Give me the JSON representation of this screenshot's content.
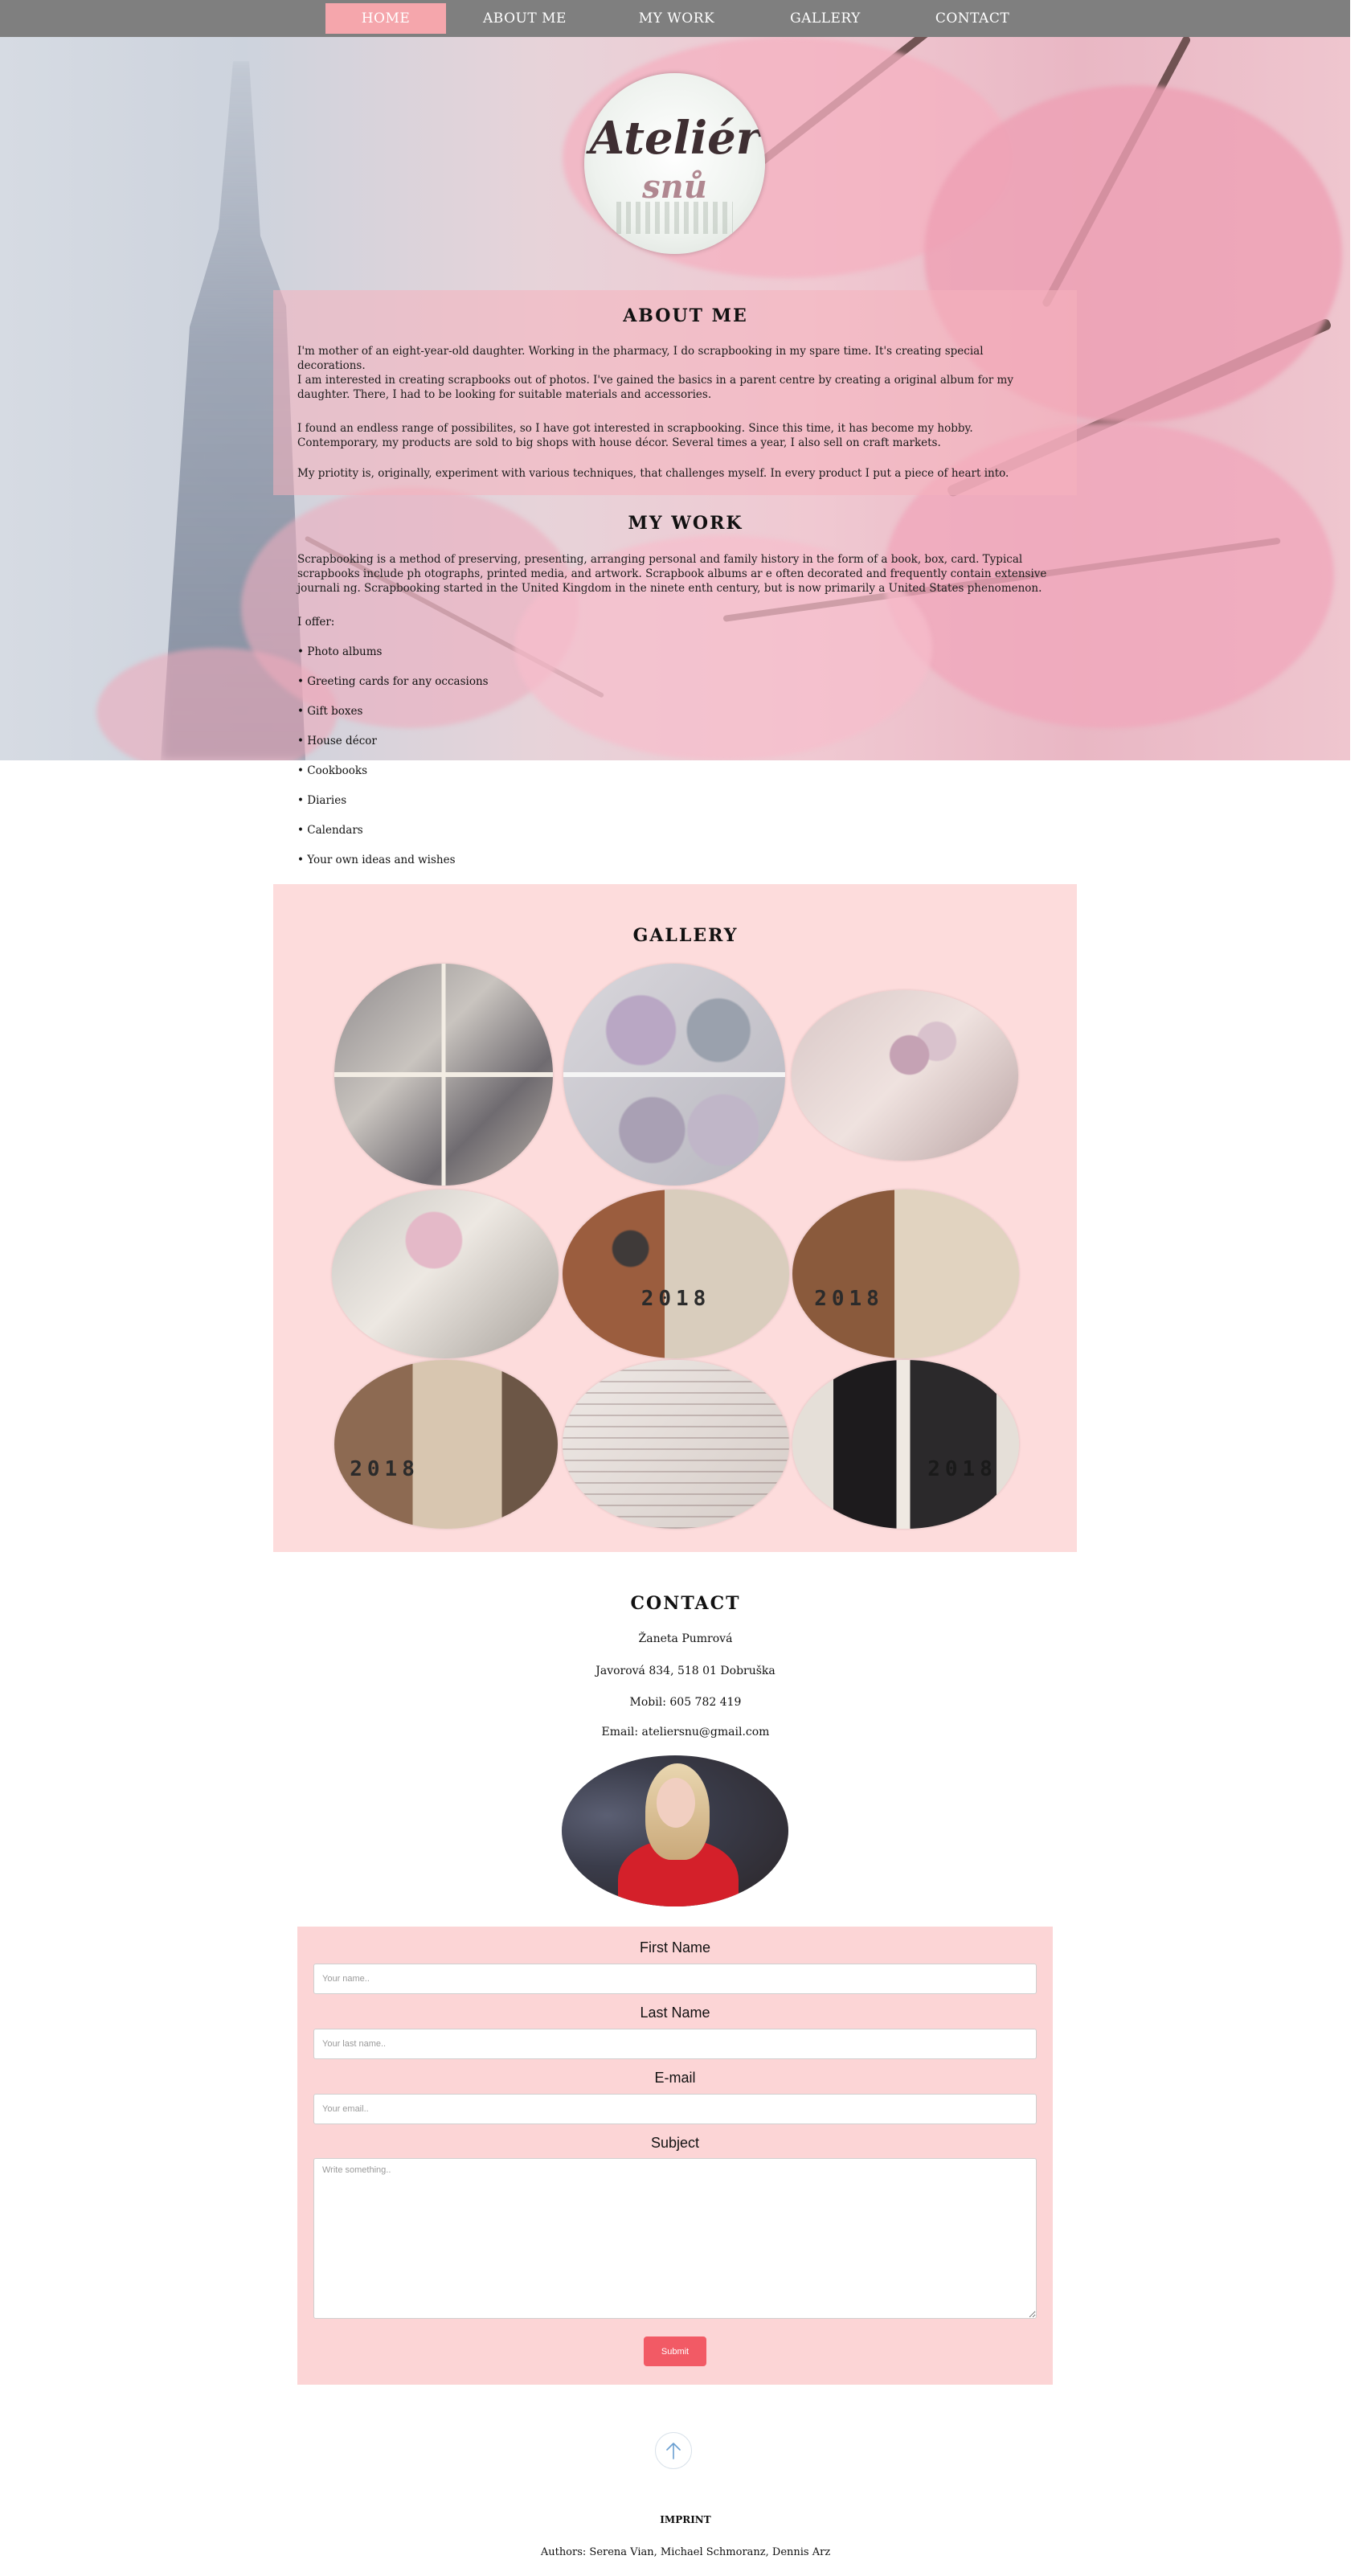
{
  "nav": {
    "items": [
      {
        "label": "HOME",
        "active": true
      },
      {
        "label": "ABOUT ME",
        "active": false
      },
      {
        "label": "MY WORK",
        "active": false
      },
      {
        "label": "GALLERY",
        "active": false
      },
      {
        "label": "CONTACT",
        "active": false
      }
    ],
    "active_color": "#f5a6ac",
    "bar_color": "#7f7f7f"
  },
  "logo": {
    "line1": "Ateliér",
    "line2": "snů"
  },
  "about": {
    "title": "ABOUT ME",
    "paragraphs": [
      "I'm mother of an eight-year-old daughter. Working in the pharmacy, I do scrapbooking in my spare time. It's creating special decorations.",
      "I am interested in creating scrapbooks out of photos. I've gained the basics in a parent centre by creating a original album for my daughter. There, I had to be looking for suitable materials and accessories.",
      "I found an endless range of possibilites, so I have got interested in scrapbooking. Since this time, it has become my hobby. Contemporary, my products are sold to big shops with house décor. Several times a year, I also sell on craft markets.",
      "My priotity is, originally, experiment with various techniques, that challenges myself. In every product I put a piece of heart into."
    ]
  },
  "work": {
    "title": "MY WORK",
    "intro": "Scrapbooking is a method of preserving, presenting, arranging personal and family history in the form of a book, box, card. Typical scrapbooks include ph otographs, printed media, and artwork. Scrapbook albums ar e often decorated and frequently contain extensive journali ng. Scrapbooking started in the United Kingdom in the ninete enth century, but is now primarily a United States phenomenon.",
    "offer_label": "I offer:",
    "offers": [
      "• Photo albums",
      "• Greeting cards for any occasions",
      "• Gift boxes",
      "• House décor",
      "• Cookbooks",
      "• Diaries",
      "• Calendars",
      "• Your own ideas and wishes"
    ]
  },
  "gallery": {
    "title": "GALLERY",
    "background": "#fddcdc",
    "photos": [
      {
        "name": "gallery-photo-card-collage",
        "caption": ""
      },
      {
        "name": "gallery-photo-jewel-boxes",
        "caption": ""
      },
      {
        "name": "gallery-photo-floral-card",
        "caption": ""
      },
      {
        "name": "gallery-photo-album-cover",
        "caption": ""
      },
      {
        "name": "gallery-photo-steampunk-calendar",
        "caption": "2018"
      },
      {
        "name": "gallery-photo-wooden-calendar",
        "caption": "2018"
      },
      {
        "name": "gallery-photo-open-calendar",
        "caption": "2018"
      },
      {
        "name": "gallery-photo-lace-calendar",
        "caption": ""
      },
      {
        "name": "gallery-photo-black-calendar",
        "caption": "2018"
      }
    ]
  },
  "contact": {
    "title": "CONTACT",
    "name": "Žaneta Pumrová",
    "address": "Javorová 834, 518 01 Dobruška",
    "phone": "Mobil: 605 782 419",
    "email": "Email: ateliersnu@gmail.com"
  },
  "form": {
    "first_name_label": "First Name",
    "first_name_placeholder": "Your name..",
    "last_name_label": "Last Name",
    "last_name_placeholder": "Your last name..",
    "email_label": "E-mail",
    "email_placeholder": "Your email..",
    "subject_label": "Subject",
    "subject_placeholder": "Write something..",
    "submit_label": "Submit",
    "background": "#fcd5d6",
    "submit_color": "#f25a65"
  },
  "footer": {
    "back_to_top_icon": "arrow-up-icon",
    "imprint_title": "IMPRINT",
    "authors": "Authors: Serena Vian, Michael Schmoranz, Dennis Arz"
  }
}
